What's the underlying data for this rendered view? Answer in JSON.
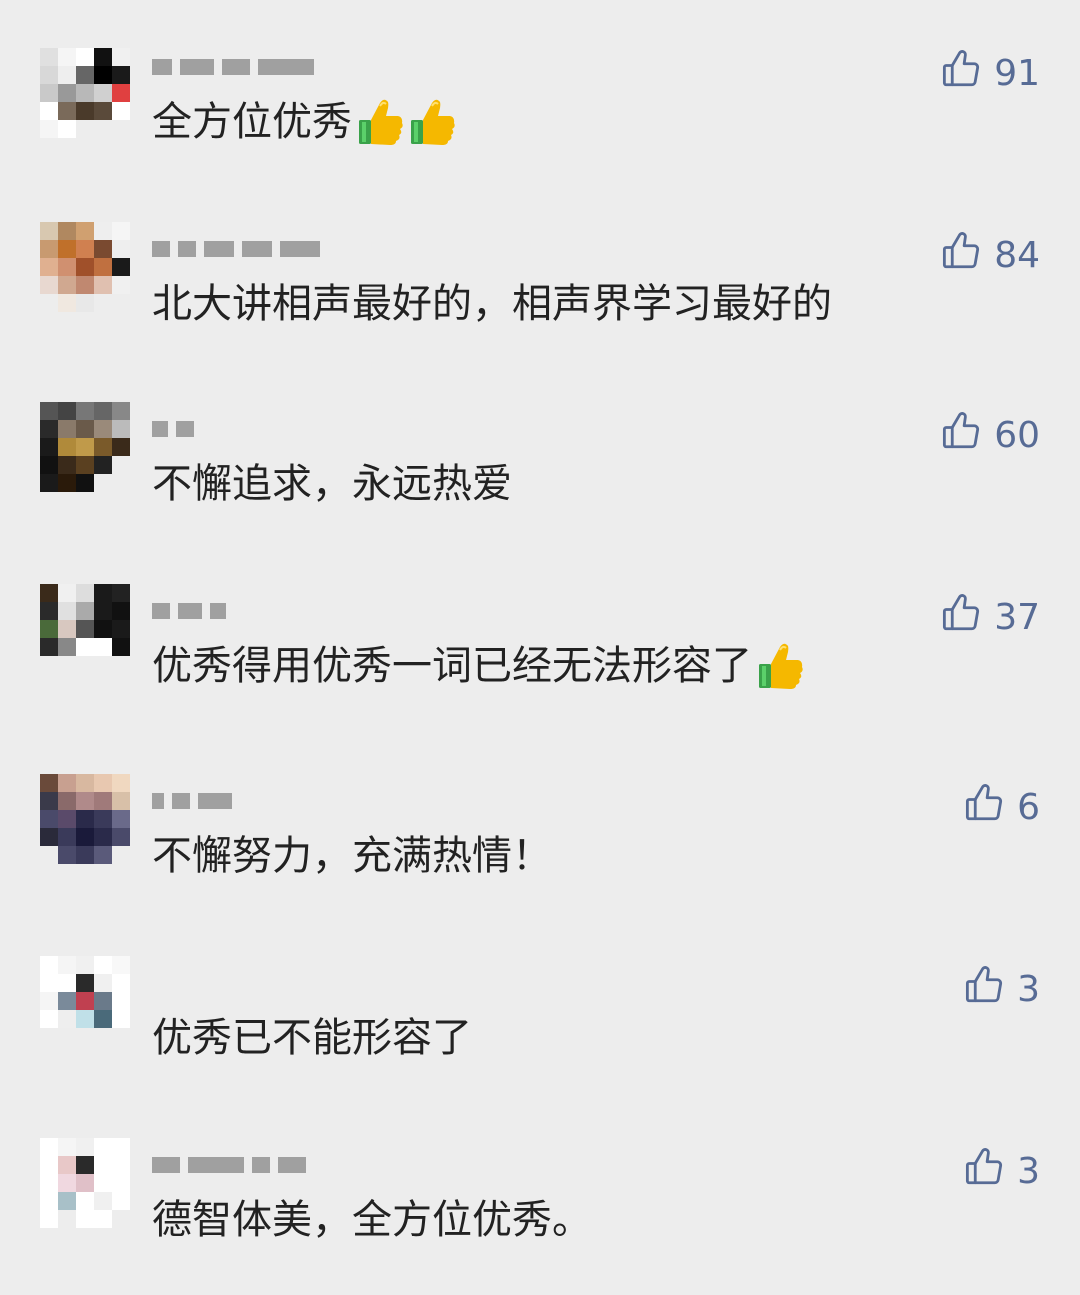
{
  "comments": [
    {
      "text": "全方位优秀",
      "emoji_count": 2,
      "emoji": "thumbs-up-emoji",
      "likes": "91",
      "avatar_colors": [
        "#e0e0e0",
        "#f5f5f5",
        "#ffffff",
        "#111111",
        "#f0f0f0",
        "#d8d8d8",
        "#eeeeee",
        "#666666",
        "#000000",
        "#1a1a1a",
        "#c9c9c9",
        "#999999",
        "#b8b8b8",
        "#d0d0d0",
        "#e04040",
        "#ffffff",
        "#7a6a5a",
        "#4a3a2a",
        "#5a4a3a",
        "#ffffff",
        "#f5f5f5",
        "#ffffff",
        "#ededed",
        "#ededed",
        "#ededed"
      ]
    },
    {
      "text": "北大讲相声最好的，相声界学习最好的",
      "emoji_count": 0,
      "emoji": "",
      "likes": "84",
      "avatar_colors": [
        "#d8c8b0",
        "#b08860",
        "#d0a070",
        "#eeeeee",
        "#f5f5f5",
        "#c89a70",
        "#c0702a",
        "#d08050",
        "#7a4a30",
        "#eeeeee",
        "#e0b090",
        "#d09070",
        "#a0502a",
        "#c07040",
        "#1a1a1a",
        "#e8d8d0",
        "#d0a890",
        "#c08870",
        "#e0c0b0",
        "#f0f0f0",
        "#ededed",
        "#f0e8e0",
        "#e8e8e8",
        "#ededed",
        "#ededed"
      ]
    },
    {
      "text": "不懈追求，永远热爱",
      "emoji_count": 0,
      "emoji": "",
      "likes": "60",
      "avatar_colors": [
        "#555555",
        "#444444",
        "#777777",
        "#666666",
        "#888888",
        "#2a2a2a",
        "#8a7a6a",
        "#6a5a4a",
        "#9a8a7a",
        "#bbbbbb",
        "#1a1a1a",
        "#b08a3a",
        "#c09a4a",
        "#7a5a2a",
        "#3a2a1a",
        "#111111",
        "#3a2a1a",
        "#5a4020",
        "#222222",
        "#ededed",
        "#1a1a1a",
        "#2a1a0a",
        "#111111",
        "#ededed",
        "#ededed"
      ]
    },
    {
      "text": "优秀得用优秀一词已经无法形容了",
      "emoji_count": 1,
      "emoji": "thumbs-up-emoji",
      "likes": "37",
      "avatar_colors": [
        "#3a2a1a",
        "#f0f0f0",
        "#dddddd",
        "#1a1a1a",
        "#222222",
        "#2a2a2a",
        "#e0e0e0",
        "#aaaaaa",
        "#1a1a1a",
        "#111111",
        "#4a6a3a",
        "#d8c8c0",
        "#555555",
        "#111111",
        "#1a1a1a",
        "#2a2a2a",
        "#888888",
        "#ffffff",
        "#ffffff",
        "#111111",
        "#ededed",
        "#ededed",
        "#ededed",
        "#ededed",
        "#ededed"
      ]
    },
    {
      "text": "不懈努力，充满热情！",
      "emoji_count": 0,
      "emoji": "",
      "likes": "6",
      "avatar_colors": [
        "#6a4a3a",
        "#c8a090",
        "#d8b8a0",
        "#e8c8b0",
        "#f0d8c0",
        "#3a3a4a",
        "#8a6a6a",
        "#b08a8a",
        "#a07a7a",
        "#d8c0a8",
        "#4a4a6a",
        "#5a4a6a",
        "#2a2a4a",
        "#3a3a5a",
        "#6a6a8a",
        "#2a2a3a",
        "#3a3a5a",
        "#1a1a3a",
        "#2a2a4a",
        "#4a4a6a",
        "#ededed",
        "#4a4a6a",
        "#3a3a5a",
        "#5a5a7a",
        "#ededed"
      ]
    },
    {
      "text": "优秀已不能形容了",
      "emoji_count": 0,
      "emoji": "",
      "likes": "3",
      "avatar_colors": [
        "#ffffff",
        "#f5f5f5",
        "#f0f0f0",
        "#ffffff",
        "#f8f8f8",
        "#ffffff",
        "#ffffff",
        "#2a2a2a",
        "#f0f0f0",
        "#ffffff",
        "#f5f5f5",
        "#7a8a9a",
        "#c04050",
        "#6a7a8a",
        "#ffffff",
        "#ffffff",
        "#eeeeee",
        "#c0e0e8",
        "#4a6a7a",
        "#ffffff",
        "#ededed",
        "#ededed",
        "#ededed",
        "#ededed",
        "#ededed"
      ]
    },
    {
      "text": "德智体美，全方位优秀。",
      "emoji_count": 0,
      "emoji": "",
      "likes": "3",
      "avatar_colors": [
        "#ffffff",
        "#f5f5f5",
        "#f0f0f0",
        "#ffffff",
        "#ffffff",
        "#ffffff",
        "#e8c8c8",
        "#2a2a2a",
        "#ffffff",
        "#ffffff",
        "#ffffff",
        "#f0d8e0",
        "#e0c0c8",
        "#ffffff",
        "#ffffff",
        "#ffffff",
        "#a8c0c8",
        "#ffffff",
        "#f0f0f0",
        "#ffffff",
        "#ffffff",
        "#ededed",
        "#ffffff",
        "#ffffff",
        "#ededed"
      ]
    }
  ],
  "colors": {
    "background": "#ededed",
    "text": "#222222",
    "like": "#576b95"
  },
  "icons": {
    "like": "thumbs-up-outline-icon"
  }
}
